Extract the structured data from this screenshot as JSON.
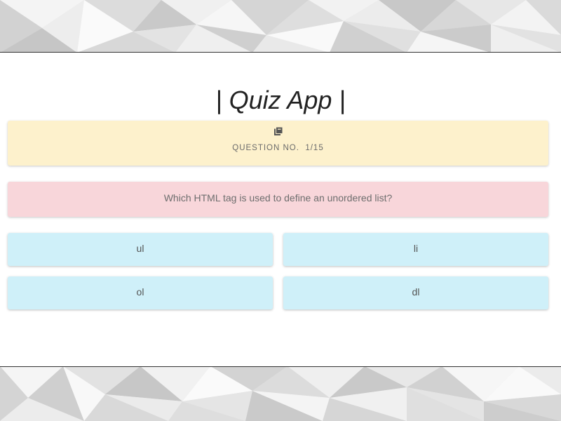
{
  "app": {
    "title": "| Quiz App |"
  },
  "question_header": {
    "icon": "book-icon",
    "label": "QUESTION NO.  1/15"
  },
  "question": {
    "text": "Which HTML tag is used to define an unordered list?"
  },
  "options": [
    {
      "label": "ul"
    },
    {
      "label": "li"
    },
    {
      "label": "ol"
    },
    {
      "label": "dl"
    }
  ],
  "colors": {
    "question_header_bg": "#fdf1cc",
    "question_bg": "#f8d6da",
    "option_bg": "#cff0f9"
  }
}
